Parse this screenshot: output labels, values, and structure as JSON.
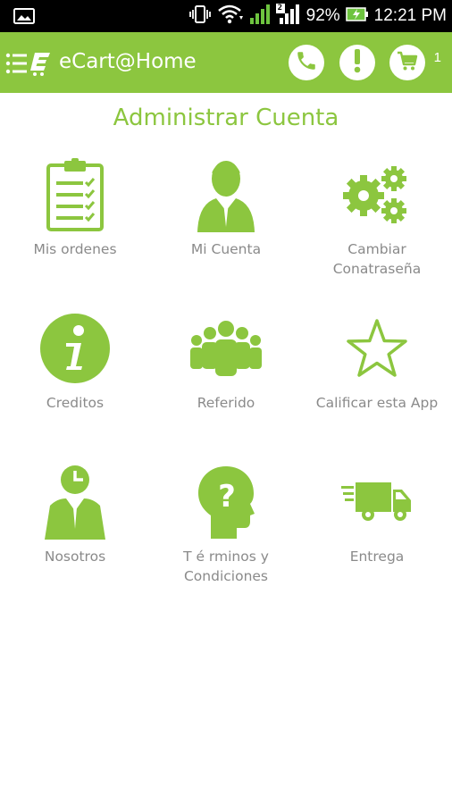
{
  "status_bar": {
    "battery_percent": "92%",
    "time": "12:21 PM",
    "sim_index": "2"
  },
  "app_bar": {
    "title": "eCart@Home",
    "cart_count": "1"
  },
  "page": {
    "title": "Administrar Cuenta"
  },
  "tiles": [
    {
      "label": "Mis ordenes",
      "icon": "clipboard-checklist-icon"
    },
    {
      "label": "Mi Cuenta",
      "icon": "user-account-icon"
    },
    {
      "label": "Cambiar Conatraseña",
      "icon": "gears-icon"
    },
    {
      "label": "Creditos",
      "icon": "info-icon"
    },
    {
      "label": "Referido",
      "icon": "group-people-icon"
    },
    {
      "label": "Calificar esta App",
      "icon": "star-icon"
    },
    {
      "label": "Nosotros",
      "icon": "businessman-clock-icon"
    },
    {
      "label": "T é rminos y Condiciones",
      "icon": "head-question-icon"
    },
    {
      "label": "Entrega",
      "icon": "delivery-truck-icon"
    }
  ],
  "colors": {
    "accent": "#8cc63f",
    "status_bar": "#000000",
    "label": "#8a8a8a"
  }
}
